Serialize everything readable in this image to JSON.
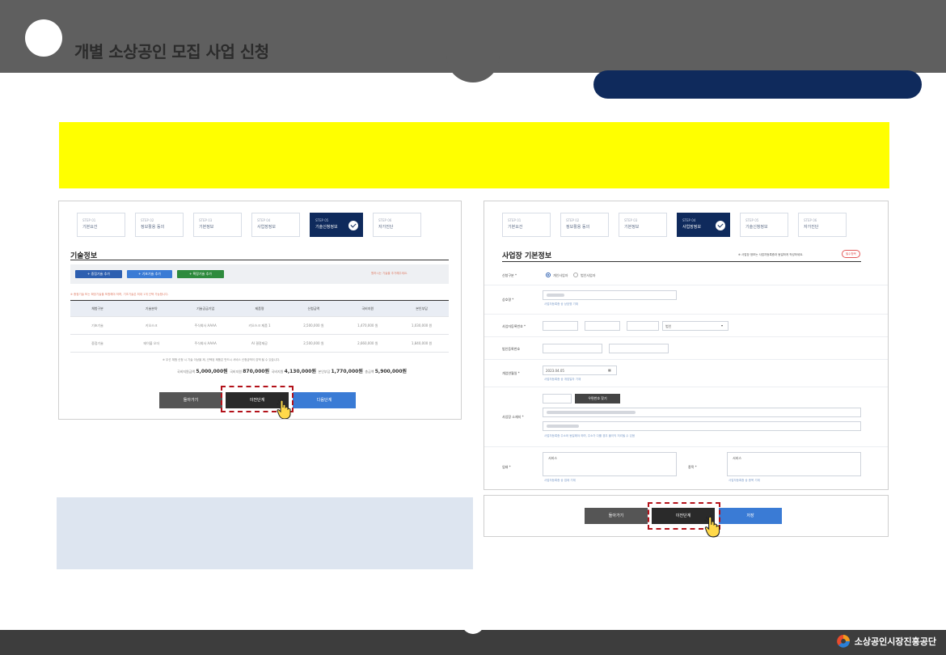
{
  "header": {
    "title": "개별 소상공인 모집 사업 신청"
  },
  "footer": {
    "org_name": "소상공인시장진흥공단"
  },
  "steps": [
    {
      "num": "STEP 01",
      "label": "기본요건"
    },
    {
      "num": "STEP 02",
      "label": "정보활용 동의"
    },
    {
      "num": "STEP 03",
      "label": "기본정보"
    },
    {
      "num": "STEP 04",
      "label": "사업장정보"
    },
    {
      "num": "STEP 05",
      "label": "기술신청정보"
    },
    {
      "num": "STEP 06",
      "label": "자가진단"
    }
  ],
  "right_steps": [
    {
      "num": "STEP 01",
      "label": "기본요건"
    },
    {
      "num": "STEP 02",
      "label": "정보활용 동의"
    },
    {
      "num": "STEP 03",
      "label": "기본정보"
    },
    {
      "num": "STEP 04",
      "label": "사업장정보"
    },
    {
      "num": "STEP 05",
      "label": "기술신청정보"
    },
    {
      "num": "STEP 06",
      "label": "자가진단"
    }
  ],
  "tech": {
    "title": "기술정보",
    "add_buttons": [
      "+ 중점기술 추가",
      "+ 기초기술 추가",
      "+ 확장기술 추가"
    ],
    "notice": "※ 중점기술 또는 확장기술을 포함해야 하며, 기초기술은 최대 1개 선택 가능합니다.",
    "right_notice": "원하시는 기술을 추가해주세요.",
    "columns": [
      "체험구분",
      "기술분야",
      "기술공급기업",
      "제품명",
      "신청금액",
      "국비지원",
      "본인부담"
    ],
    "rows": [
      [
        "기초기술",
        "키오스크",
        "주식회사 AAAA",
        "키오스크 제품 1",
        "2,500,000 원",
        "1,470,000 원",
        "1,030,000 원"
      ],
      [
        "중점기술",
        "테이블 오더",
        "주식회사 AAAA",
        "AI 결정제공",
        "2,500,000 원",
        "2,660,000 원",
        "1,840,000 원"
      ]
    ],
    "sum_note": "※ 우선 체험 신청 시 기술 이상을 제, 선택된 제품은 반드시 서비스 신청금액이 감액 될 수 있습니다.",
    "totals": [
      {
        "label": "국비지원금액",
        "value": "5,000,000원"
      },
      {
        "label": "국비지원",
        "value": "870,000원"
      },
      {
        "label": "국비지원",
        "value": "4,130,000원"
      },
      {
        "label": "본인부담",
        "value": "1,770,000원"
      },
      {
        "label": "총금액",
        "value": "5,900,000원"
      }
    ],
    "btn_back": "돌아가기",
    "btn_prev": "이전단계",
    "btn_next": "다음단계"
  },
  "biz": {
    "title": "사업장 기본정보",
    "notice": "※ 사업장 정보는 사업자등록증과 동일하게 작성하세요.",
    "badge": "필수항목",
    "labels": {
      "type": "신청구분 *",
      "name": "상호명 *",
      "reg_no": "사업자등록번호 *",
      "corp_no": "법인등록번호",
      "open_date": "개업연월일 *",
      "address": "사업장 소재지 *",
      "biz_type": "업태 *",
      "biz_item": "종목 *"
    },
    "radio_options": [
      "개인사업자",
      "법인사업자"
    ],
    "name_hint": "사업자등록증 상 상호명 기재",
    "reg_select": "법인",
    "open_date_value": "2023.04.05",
    "open_hint": "사업자등록증 상 개업일자 기재",
    "zip_btn": "우편번호 찾기",
    "addr_hint": "사업자등록증 주소와 동일해야 하며, 주소가 다를 경우 불이익 처리될 수 있음",
    "biz_type_value": "서비스",
    "biz_item_value": "서비스",
    "type_hint": "사업자등록증 상 업태 기재",
    "item_hint": "사업자등록증 상 종목 기재",
    "btn_back": "돌아가기",
    "btn_prev": "이전단계",
    "btn_save": "저장"
  },
  "colors": {
    "navy": "#0f2a5c",
    "yellow": "#ffff00",
    "header_gray": "#5f5f5f",
    "highlight_red": "#b3121a",
    "blue_button": "#3a7bd5"
  }
}
